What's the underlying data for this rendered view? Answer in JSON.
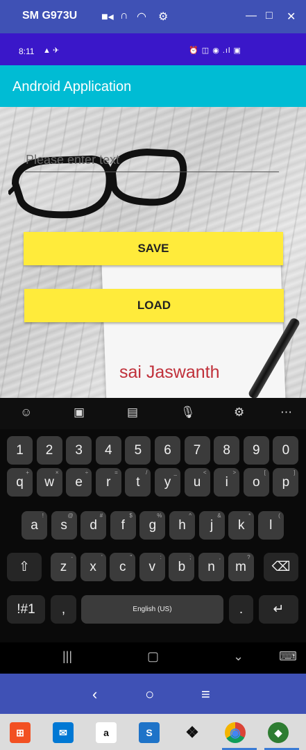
{
  "window": {
    "device_name": "SM G973U",
    "icons": [
      "video-camera-icon",
      "headphones-icon",
      "wifi-icon",
      "gear-icon"
    ],
    "controls": [
      "minimize-icon",
      "maximize-icon",
      "close-icon"
    ]
  },
  "status_bar": {
    "time": "8:11",
    "left_icons_text": "▲ ✈",
    "right_icons_text": "⏰ ◫ ◉ .ıl ▣"
  },
  "app": {
    "title": "Android Application",
    "input_placeholder": "Please enter text",
    "save_label": "SAVE",
    "load_label": "LOAD",
    "signature_text": "sai Jaswanth"
  },
  "keyboard": {
    "toolbar": [
      "emoji-icon",
      "sticker-icon",
      "gif-icon",
      "microphone-icon",
      "gear-icon",
      "more-icon"
    ],
    "toolbar_glyphs": [
      "☺",
      "▣",
      "▤",
      "🎙",
      "⚙",
      "⋯"
    ],
    "row_numbers": [
      "1",
      "2",
      "3",
      "4",
      "5",
      "6",
      "7",
      "8",
      "9",
      "0"
    ],
    "row_top": [
      {
        "k": "q",
        "s": "+"
      },
      {
        "k": "w",
        "s": "×"
      },
      {
        "k": "e",
        "s": "÷"
      },
      {
        "k": "r",
        "s": "="
      },
      {
        "k": "t",
        "s": "/"
      },
      {
        "k": "y",
        "s": "_"
      },
      {
        "k": "u",
        "s": "<"
      },
      {
        "k": "i",
        "s": ">"
      },
      {
        "k": "o",
        "s": "["
      },
      {
        "k": "p",
        "s": "]"
      }
    ],
    "row_mid": [
      {
        "k": "a",
        "s": "!"
      },
      {
        "k": "s",
        "s": "@"
      },
      {
        "k": "d",
        "s": "#"
      },
      {
        "k": "f",
        "s": "$"
      },
      {
        "k": "g",
        "s": "%"
      },
      {
        "k": "h",
        "s": "^"
      },
      {
        "k": "j",
        "s": "&"
      },
      {
        "k": "k",
        "s": "*"
      },
      {
        "k": "l",
        "s": "("
      }
    ],
    "row_bottom": [
      {
        "k": "z",
        "s": "-"
      },
      {
        "k": "x",
        "s": "'"
      },
      {
        "k": "c",
        "s": "\""
      },
      {
        "k": "v",
        "s": ":"
      },
      {
        "k": "b",
        "s": ";"
      },
      {
        "k": "n",
        "s": ","
      },
      {
        "k": "m",
        "s": "?"
      }
    ],
    "shift_glyph": "⇧",
    "backspace_glyph": "⌫",
    "symbols_label": "!#1",
    "comma_label": ",",
    "space_label": "English (US)",
    "period_label": ".",
    "enter_glyph": "↵"
  },
  "system_nav": {
    "recents_glyph": "|||",
    "home_glyph": "▢",
    "hide_keyboard_glyph": "⌄",
    "keyboard_switch_glyph": "⌨"
  },
  "emulator_nav": {
    "back_glyph": "‹",
    "home_glyph": "○",
    "menu_glyph": "≡"
  },
  "taskbar": {
    "apps": [
      {
        "name": "store-icon",
        "glyph": "⊞",
        "color": "#f25022"
      },
      {
        "name": "mail-icon",
        "glyph": "✉",
        "color": "#0078d4"
      },
      {
        "name": "amazon-icon",
        "glyph": "a",
        "color": "#ffffff"
      },
      {
        "name": "app-blue-icon",
        "glyph": "S",
        "color": "#1e73c8"
      },
      {
        "name": "dropbox-icon",
        "glyph": "❖",
        "color": "#0061fe"
      },
      {
        "name": "chrome-icon",
        "glyph": "◉",
        "color": "#db4437"
      },
      {
        "name": "android-studio-icon",
        "glyph": "◆",
        "color": "#3ddc84"
      }
    ]
  }
}
